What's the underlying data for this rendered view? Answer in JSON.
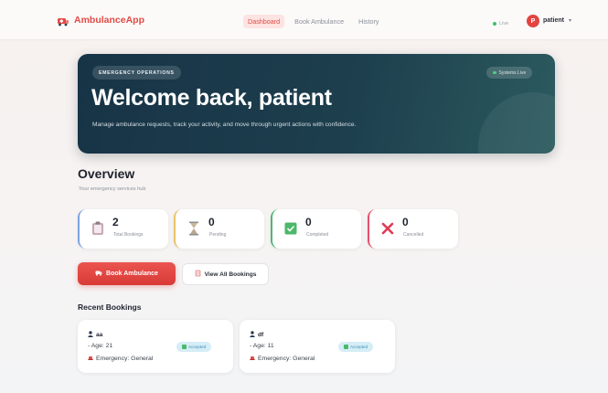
{
  "nav": {
    "brand": "AmbulanceApp",
    "links": [
      {
        "label": "Dashboard",
        "active": true
      },
      {
        "label": "Book Ambulance",
        "active": false
      },
      {
        "label": "History",
        "active": false
      }
    ],
    "live_status": "Live",
    "avatar_initial": "P",
    "user_name": "patient",
    "caret": "▾"
  },
  "hero": {
    "badge": "EMERGENCY OPERATIONS",
    "status": "Systems Live",
    "title": "Welcome back, patient",
    "subtitle": "Manage ambulance requests, track your activity, and move through urgent actions with confidence."
  },
  "overview": {
    "title": "Overview",
    "subtitle": "Your emergency services hub",
    "stats": [
      {
        "value": "2",
        "label": "Total Bookings",
        "icon": "clipboard-icon",
        "color": "#7aa3e0"
      },
      {
        "value": "0",
        "label": "Pending",
        "icon": "hourglass-icon",
        "color": "#e8c36a"
      },
      {
        "value": "0",
        "label": "Completed",
        "icon": "check-box-icon",
        "color": "#4db872"
      },
      {
        "value": "0",
        "label": "Cancelled",
        "icon": "cross-icon",
        "color": "#e6506b"
      }
    ]
  },
  "actions": {
    "book": "Book Ambulance",
    "view_all": "View All Bookings"
  },
  "recent": {
    "title": "Recent Bookings",
    "bookings": [
      {
        "name": "aa",
        "age": "- Age: 21",
        "emergency": "Emergency: General",
        "status": "Accepted"
      },
      {
        "name": "df",
        "age": "- Age: 11",
        "emergency": "Emergency: General",
        "status": "Accepted"
      }
    ]
  },
  "colors": {
    "accent": "#e04b46",
    "hero_dark": "#173447",
    "badge_bg": "#d5edf6"
  }
}
